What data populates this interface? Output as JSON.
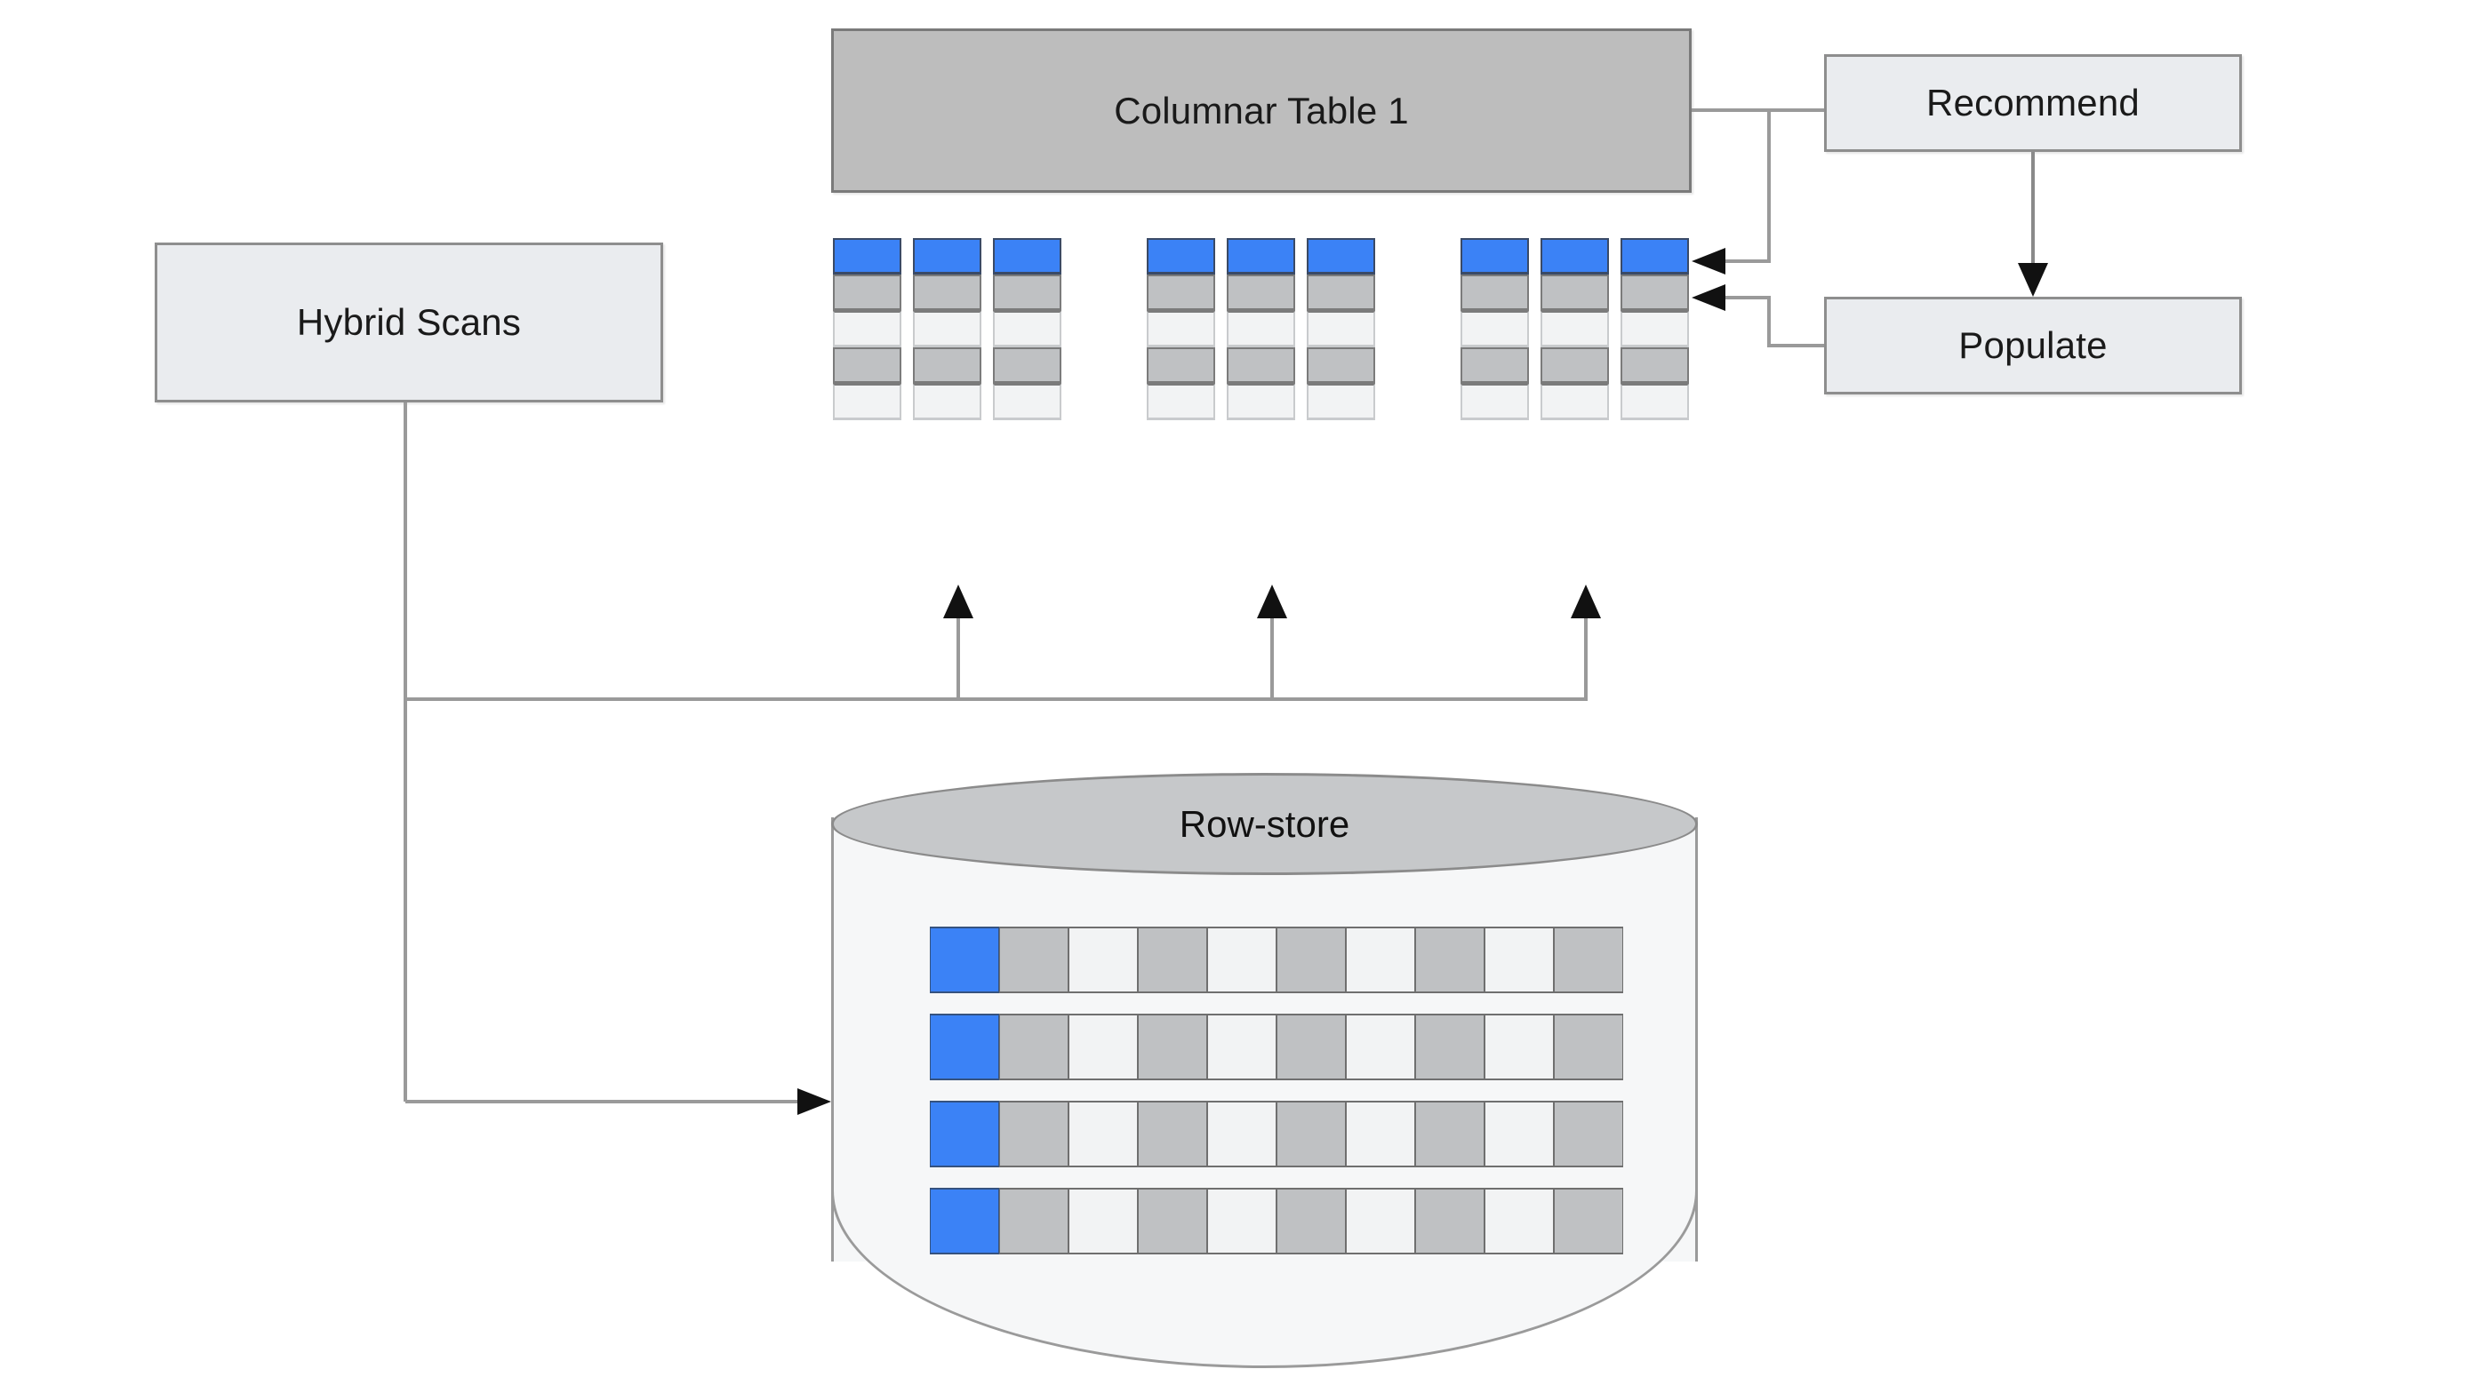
{
  "diagram": {
    "title": "Hybrid columnar / row-store architecture",
    "type": "architecture-flow"
  },
  "nodes": {
    "columnar_table": {
      "label": "Columnar Table 1",
      "fill": "#bdbdbd",
      "stroke": "#7a7a7a"
    },
    "hybrid_scans": {
      "label": "Hybrid Scans",
      "fill": "#eaecef",
      "stroke": "#8e8e8e"
    },
    "recommend": {
      "label": "Recommend",
      "fill": "#eaecef",
      "stroke": "#8e8e8e"
    },
    "populate": {
      "label": "Populate",
      "fill": "#eaecef",
      "stroke": "#8e8e8e"
    },
    "row_store": {
      "label": "Row-store",
      "fill": "#c6c8ca",
      "stroke": "#8b8b8b"
    }
  },
  "colors": {
    "accent_blue": "#3b82f6",
    "cell_gray": "#bfc1c3",
    "cell_light": "#f2f3f4",
    "box_gray": "#bdbdbd",
    "box_light": "#eaecef",
    "border": "#8e8e8e",
    "wire": "#9a9a9a",
    "text": "#1a1a1a"
  },
  "columnar_cells": {
    "groups": 3,
    "columns_per_group": 3,
    "cells_per_column": 5,
    "pattern": [
      "blue",
      "gray",
      "light",
      "gray",
      "light"
    ]
  },
  "row_store_grid": {
    "rows": 4,
    "cells_per_row": 10,
    "pattern": [
      "blue",
      "gray",
      "light",
      "gray",
      "light",
      "gray",
      "light",
      "gray",
      "light",
      "gray"
    ]
  },
  "edges": [
    {
      "from": "columnar_table",
      "to": "recommend",
      "arrow": false
    },
    {
      "from": "recommend",
      "to": "populate",
      "arrow": true
    },
    {
      "from": "recommend",
      "to": "columnar_cells",
      "arrow": true
    },
    {
      "from": "populate",
      "to": "columnar_cells",
      "arrow": true
    },
    {
      "from": "hybrid_scans",
      "to": "columnar_cells",
      "arrow": true
    },
    {
      "from": "hybrid_scans",
      "to": "row_store",
      "arrow": true
    }
  ]
}
